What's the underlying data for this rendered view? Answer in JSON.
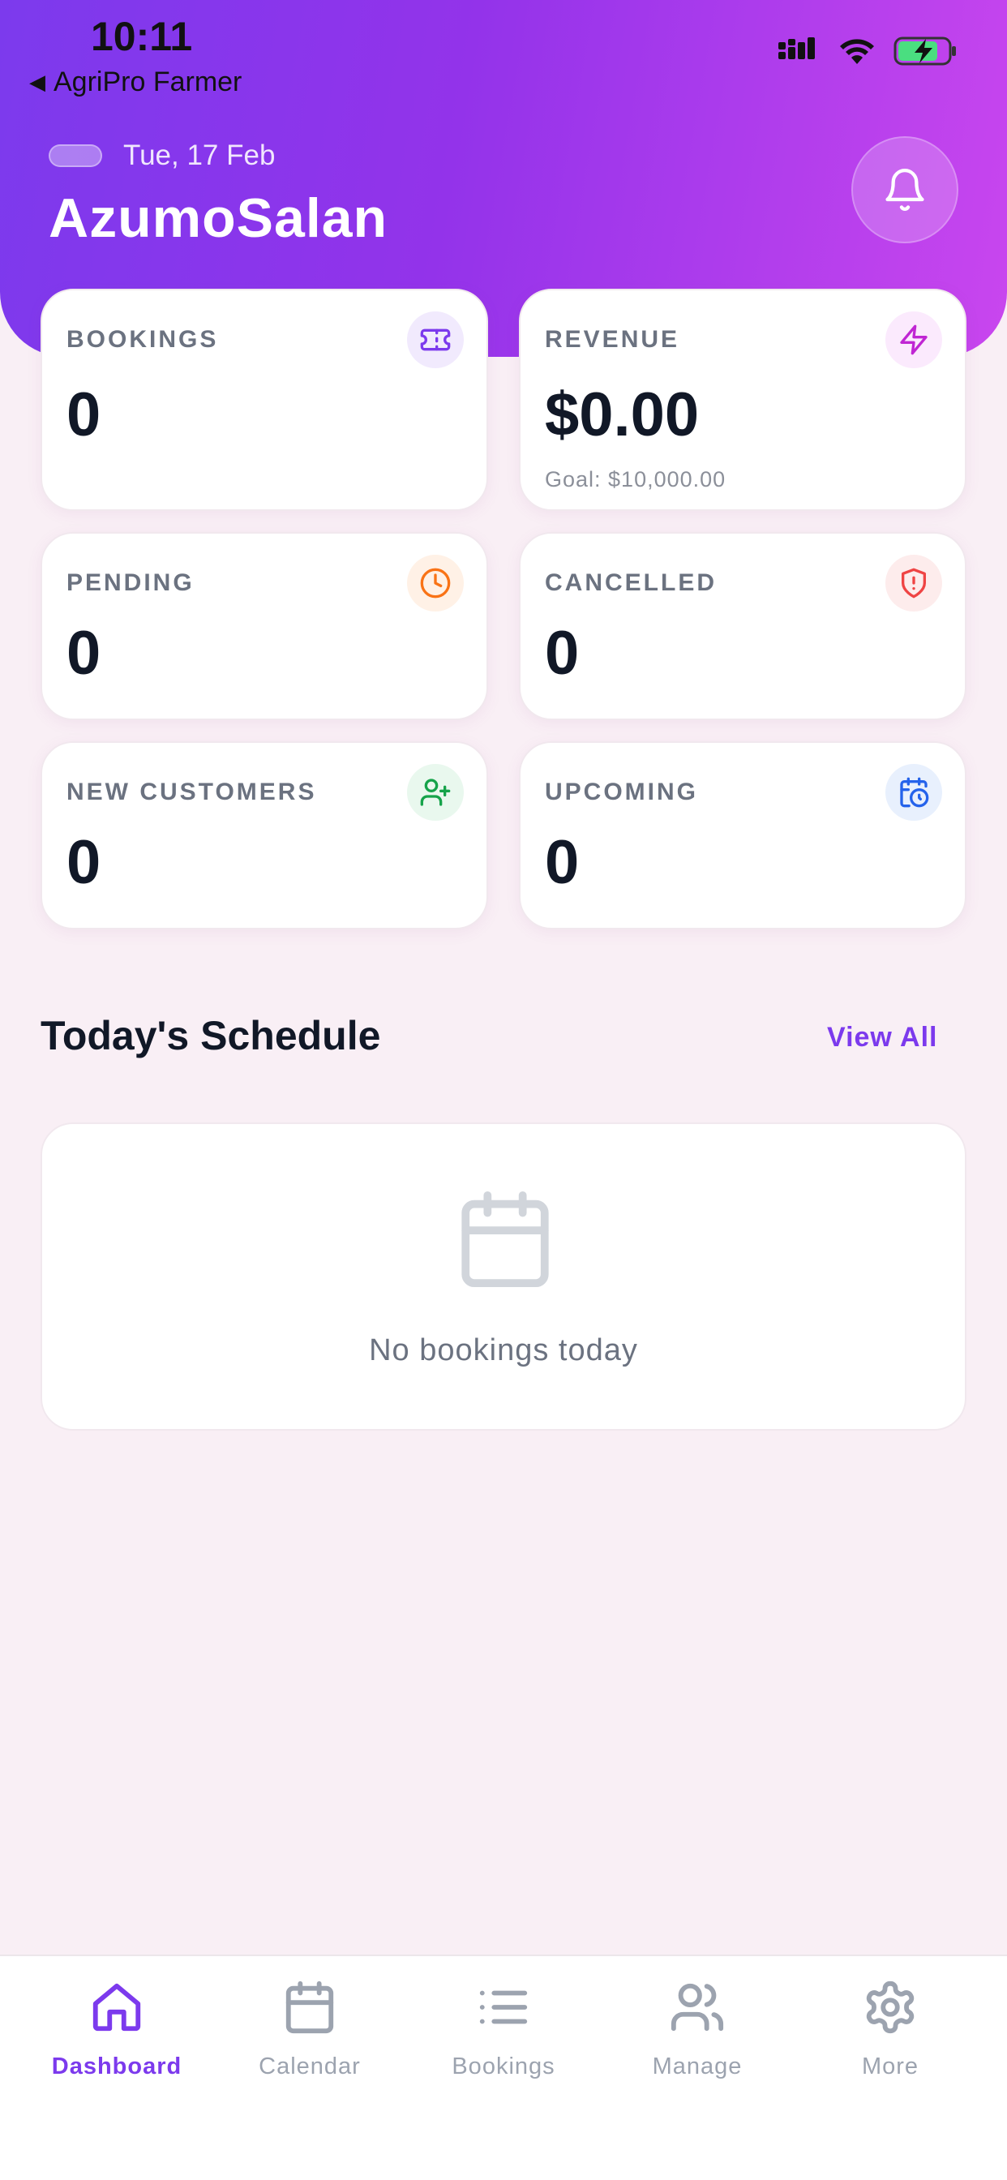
{
  "status_bar": {
    "time": "10:11",
    "back_app": "AgriPro Farmer"
  },
  "header": {
    "date": "Tue, 17 Feb",
    "user_name": "AzumoSalan"
  },
  "stats": {
    "bookings": {
      "label": "BOOKINGS",
      "value": "0",
      "icon": "ticket-icon"
    },
    "revenue": {
      "label": "REVENUE",
      "value": "$0.00",
      "goal": "Goal: $10,000.00",
      "icon": "lightning-icon"
    },
    "pending": {
      "label": "PENDING",
      "value": "0",
      "icon": "clock-icon"
    },
    "cancelled": {
      "label": "CANCELLED",
      "value": "0",
      "icon": "shield-alert-icon"
    },
    "new_customers": {
      "label": "NEW CUSTOMERS",
      "value": "0",
      "icon": "user-plus-icon"
    },
    "upcoming": {
      "label": "UPCOMING",
      "value": "0",
      "icon": "calendar-clock-icon"
    }
  },
  "schedule": {
    "title": "Today's Schedule",
    "view_all": "View All",
    "empty_text": "No bookings today"
  },
  "tabs": [
    {
      "label": "Dashboard",
      "icon": "home-icon",
      "active": true
    },
    {
      "label": "Calendar",
      "icon": "calendar-icon",
      "active": false
    },
    {
      "label": "Bookings",
      "icon": "list-icon",
      "active": false
    },
    {
      "label": "Manage",
      "icon": "users-icon",
      "active": false
    },
    {
      "label": "More",
      "icon": "gear-icon",
      "active": false
    }
  ],
  "colors": {
    "accent": "#7c3aed",
    "header_gradient_start": "#7c3aed",
    "header_gradient_end": "#c946ee",
    "background": "#f9eff5"
  }
}
